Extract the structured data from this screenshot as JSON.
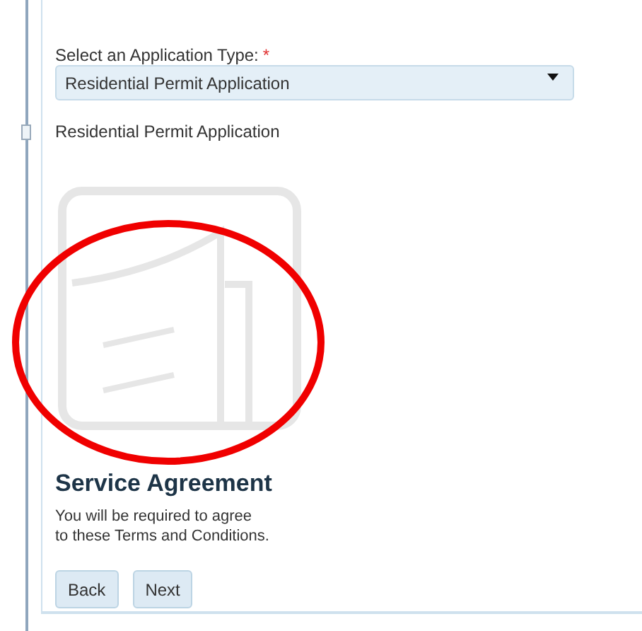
{
  "form": {
    "label": "Select an Application Type:",
    "required_mark": "*",
    "select": {
      "value": "Residential Permit Application"
    },
    "selection_text": "Residential Permit Application"
  },
  "agreement": {
    "title": "Service Agreement",
    "text": "You will be required to agree\nto these Terms and Conditions."
  },
  "buttons": [
    {
      "label": "Back"
    },
    {
      "label": "Next"
    }
  ]
}
